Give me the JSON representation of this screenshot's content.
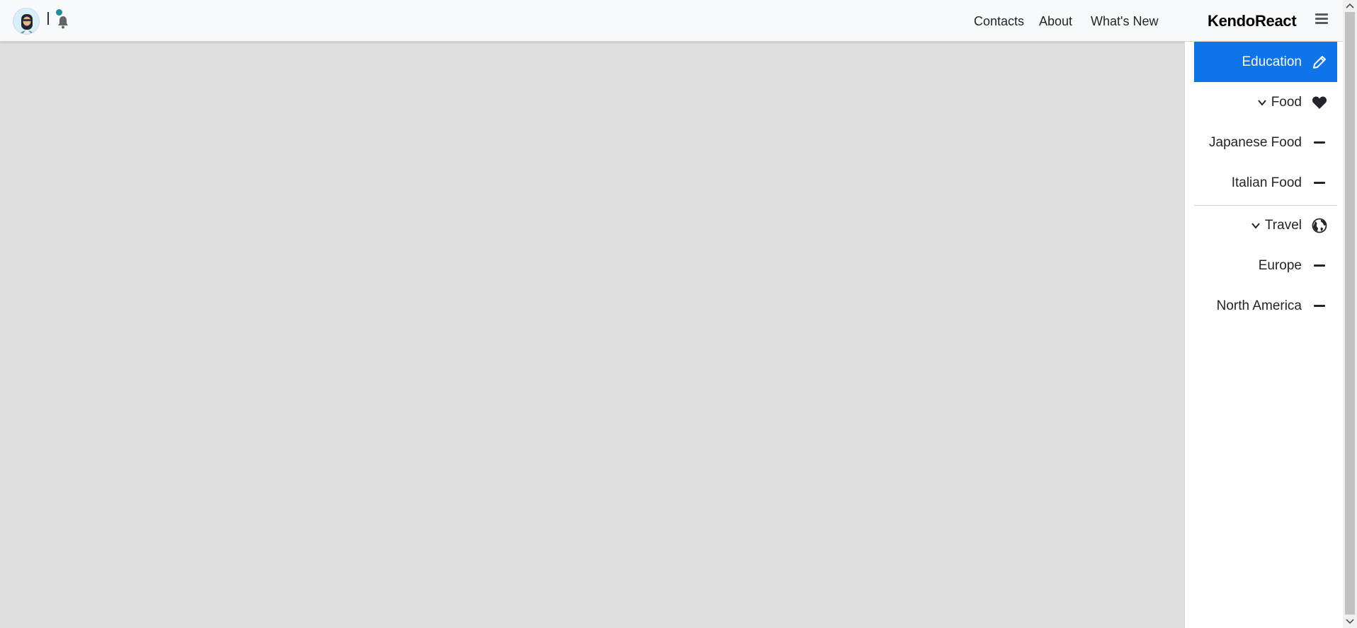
{
  "header": {
    "nav": [
      "Contacts",
      "About",
      "What's New"
    ],
    "brand": "KendoReact"
  },
  "drawer": {
    "items": [
      {
        "label": "Education",
        "icon": "pencil-icon",
        "selected": true
      },
      {
        "label": "Food",
        "icon": "heart-icon",
        "expanded": true
      },
      {
        "label": "Japanese Food",
        "icon": "minus-icon"
      },
      {
        "label": "Italian Food",
        "icon": "minus-icon"
      },
      {
        "label": "Travel",
        "icon": "globe-icon",
        "expanded": true
      },
      {
        "label": "Europe",
        "icon": "minus-icon"
      },
      {
        "label": "North America",
        "icon": "minus-icon"
      }
    ]
  },
  "colors": {
    "accent": "#0e74e8",
    "badge": "#1a8fa0",
    "content_bg": "#dedede"
  }
}
